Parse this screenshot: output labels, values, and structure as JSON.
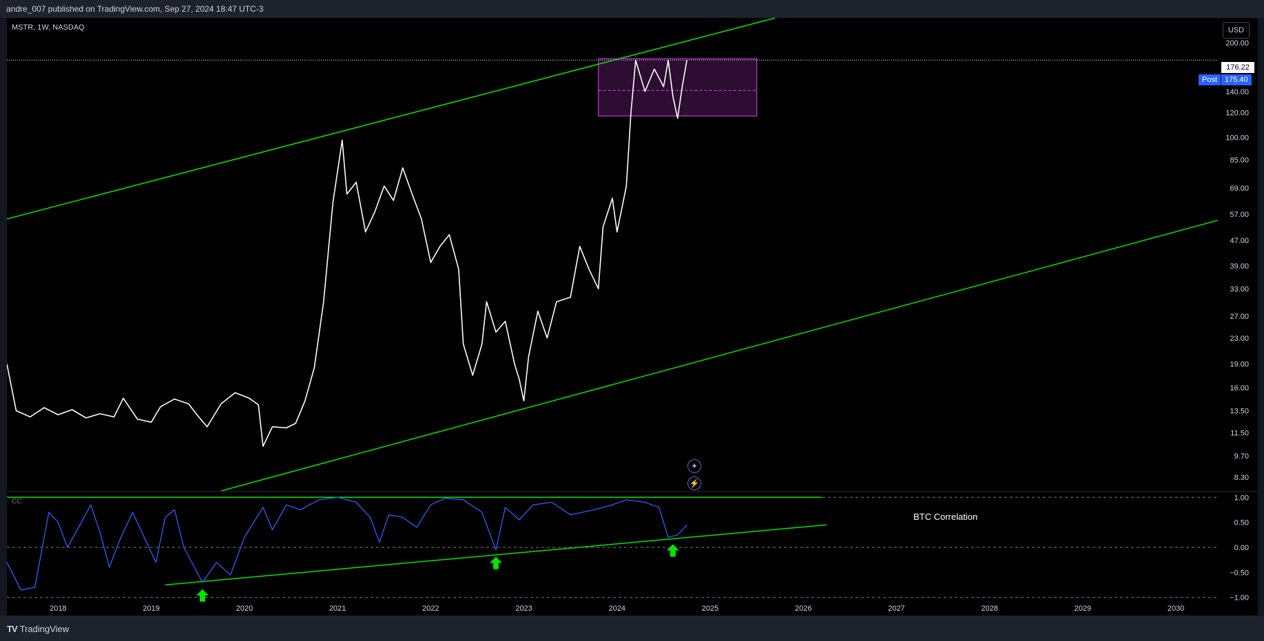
{
  "header": {
    "published": "andre_007 published on TradingView.com, Sep 27, 2024 18:47 UTC-3"
  },
  "symbol": {
    "label": "MSTR, 1W, NASDAQ"
  },
  "currency_button": "USD",
  "last_price": "176.22",
  "post_market": {
    "label": "Post",
    "price": "175.40"
  },
  "indicator": {
    "short_name": "CC",
    "annotation": "BTC Correlation"
  },
  "footer": {
    "brand": "TradingView"
  },
  "colors": {
    "background": "#000000",
    "price_line": "#ffffff",
    "channel": "#00e600",
    "range_box": "#e040fb",
    "correlation": "#2962ff",
    "arrow": "#00e600"
  },
  "icons": [
    "sparkle-icon",
    "lightning-icon",
    "arrow-up-icon",
    "tradingview-logo-icon"
  ],
  "chart_data": [
    {
      "type": "line",
      "name": "MSTR price (log scale)",
      "y_scale": "log",
      "x_ticks": [
        "2018",
        "2019",
        "2020",
        "2021",
        "2022",
        "2023",
        "2024",
        "2025",
        "2026",
        "2027",
        "2028",
        "2029",
        "2030"
      ],
      "y_ticks": [
        "200.00",
        "176.22",
        "140.00",
        "120.00",
        "100.00",
        "85.00",
        "69.00",
        "57.00",
        "47.00",
        "39.00",
        "33.00",
        "27.00",
        "23.00",
        "19.00",
        "16.00",
        "13.50",
        "11.50",
        "9.70",
        "8.30"
      ],
      "x_range": [
        2017.45,
        2030.45
      ],
      "y_range": [
        7.5,
        240
      ],
      "points": [
        [
          2017.45,
          19.0
        ],
        [
          2017.55,
          13.5
        ],
        [
          2017.7,
          12.9
        ],
        [
          2017.85,
          13.8
        ],
        [
          2018.0,
          13.1
        ],
        [
          2018.15,
          13.6
        ],
        [
          2018.3,
          12.8
        ],
        [
          2018.45,
          13.2
        ],
        [
          2018.6,
          12.9
        ],
        [
          2018.7,
          14.8
        ],
        [
          2018.85,
          12.7
        ],
        [
          2019.0,
          12.4
        ],
        [
          2019.1,
          13.9
        ],
        [
          2019.25,
          14.7
        ],
        [
          2019.4,
          14.2
        ],
        [
          2019.5,
          13.0
        ],
        [
          2019.6,
          12.0
        ],
        [
          2019.75,
          14.2
        ],
        [
          2019.9,
          15.4
        ],
        [
          2020.05,
          14.8
        ],
        [
          2020.15,
          14.1
        ],
        [
          2020.2,
          10.4
        ],
        [
          2020.3,
          12.0
        ],
        [
          2020.45,
          11.9
        ],
        [
          2020.55,
          12.3
        ],
        [
          2020.65,
          14.5
        ],
        [
          2020.75,
          18.5
        ],
        [
          2020.85,
          30.0
        ],
        [
          2020.95,
          62.0
        ],
        [
          2021.05,
          98.0
        ],
        [
          2021.1,
          66.0
        ],
        [
          2021.2,
          72.0
        ],
        [
          2021.3,
          50.0
        ],
        [
          2021.4,
          58.0
        ],
        [
          2021.5,
          70.0
        ],
        [
          2021.6,
          63.0
        ],
        [
          2021.7,
          80.0
        ],
        [
          2021.8,
          66.0
        ],
        [
          2021.9,
          55.0
        ],
        [
          2022.0,
          40.0
        ],
        [
          2022.1,
          45.0
        ],
        [
          2022.2,
          49.0
        ],
        [
          2022.3,
          38.0
        ],
        [
          2022.35,
          22.0
        ],
        [
          2022.45,
          17.5
        ],
        [
          2022.55,
          22.0
        ],
        [
          2022.6,
          30.0
        ],
        [
          2022.7,
          24.0
        ],
        [
          2022.8,
          26.0
        ],
        [
          2022.9,
          19.0
        ],
        [
          2022.95,
          17.0
        ],
        [
          2023.0,
          14.5
        ],
        [
          2023.05,
          20.0
        ],
        [
          2023.15,
          28.0
        ],
        [
          2023.25,
          23.0
        ],
        [
          2023.35,
          30.0
        ],
        [
          2023.5,
          31.0
        ],
        [
          2023.6,
          45.0
        ],
        [
          2023.7,
          38.0
        ],
        [
          2023.8,
          33.0
        ],
        [
          2023.85,
          52.0
        ],
        [
          2023.95,
          64.0
        ],
        [
          2024.0,
          50.0
        ],
        [
          2024.1,
          70.0
        ],
        [
          2024.15,
          120.0
        ],
        [
          2024.2,
          176.0
        ],
        [
          2024.3,
          140.0
        ],
        [
          2024.4,
          165.0
        ],
        [
          2024.5,
          145.0
        ],
        [
          2024.55,
          176.0
        ],
        [
          2024.6,
          135.0
        ],
        [
          2024.65,
          115.0
        ],
        [
          2024.7,
          145.0
        ],
        [
          2024.75,
          176.22
        ]
      ],
      "channel_lines": [
        {
          "x": [
            2017.45,
            2025.7
          ],
          "y": [
            55.0,
            240.0
          ]
        },
        {
          "x": [
            2019.75,
            2030.6
          ],
          "y": [
            7.5,
            56.0
          ]
        }
      ],
      "range_box": {
        "x": [
          2023.8,
          2025.5
        ],
        "y": [
          117.0,
          178.0
        ],
        "mid": 141.0
      },
      "last_value": 176.22
    },
    {
      "type": "line",
      "name": "BTC Correlation",
      "y_ticks": [
        "1.00",
        "0.50",
        "0.00",
        "−0.50",
        "−1.00"
      ],
      "y_range": [
        -1.1,
        1.1
      ],
      "points": [
        [
          2017.45,
          -0.3
        ],
        [
          2017.6,
          -0.85
        ],
        [
          2017.75,
          -0.8
        ],
        [
          2017.85,
          0.2
        ],
        [
          2017.9,
          0.7
        ],
        [
          2018.0,
          0.5
        ],
        [
          2018.1,
          0.0
        ],
        [
          2018.25,
          0.5
        ],
        [
          2018.35,
          0.85
        ],
        [
          2018.45,
          0.3
        ],
        [
          2018.55,
          -0.4
        ],
        [
          2018.65,
          0.1
        ],
        [
          2018.8,
          0.7
        ],
        [
          2018.95,
          0.1
        ],
        [
          2019.05,
          -0.3
        ],
        [
          2019.15,
          0.6
        ],
        [
          2019.25,
          0.75
        ],
        [
          2019.35,
          0.0
        ],
        [
          2019.55,
          -0.7
        ],
        [
          2019.7,
          -0.3
        ],
        [
          2019.85,
          -0.55
        ],
        [
          2020.0,
          0.2
        ],
        [
          2020.1,
          0.5
        ],
        [
          2020.2,
          0.8
        ],
        [
          2020.3,
          0.35
        ],
        [
          2020.45,
          0.85
        ],
        [
          2020.6,
          0.75
        ],
        [
          2020.8,
          0.95
        ],
        [
          2021.0,
          1.0
        ],
        [
          2021.2,
          0.9
        ],
        [
          2021.35,
          0.6
        ],
        [
          2021.45,
          0.1
        ],
        [
          2021.55,
          0.65
        ],
        [
          2021.7,
          0.6
        ],
        [
          2021.85,
          0.4
        ],
        [
          2022.0,
          0.85
        ],
        [
          2022.15,
          0.98
        ],
        [
          2022.35,
          0.95
        ],
        [
          2022.55,
          0.7
        ],
        [
          2022.7,
          -0.05
        ],
        [
          2022.8,
          0.8
        ],
        [
          2022.95,
          0.55
        ],
        [
          2023.1,
          0.85
        ],
        [
          2023.3,
          0.9
        ],
        [
          2023.5,
          0.65
        ],
        [
          2023.75,
          0.75
        ],
        [
          2023.95,
          0.85
        ],
        [
          2024.1,
          0.95
        ],
        [
          2024.3,
          0.9
        ],
        [
          2024.45,
          0.8
        ],
        [
          2024.55,
          0.2
        ],
        [
          2024.65,
          0.25
        ],
        [
          2024.75,
          0.45
        ]
      ],
      "support_line": {
        "x": [
          2019.15,
          2026.25
        ],
        "y": [
          -0.75,
          0.45
        ]
      },
      "reference_lines": [
        1.0,
        0.0,
        -1.0
      ],
      "upper_green_line": {
        "x": [
          2017.45,
          2026.2
        ],
        "y": 1.0
      },
      "arrows_at": [
        2019.55,
        2022.7,
        2024.6
      ]
    }
  ]
}
